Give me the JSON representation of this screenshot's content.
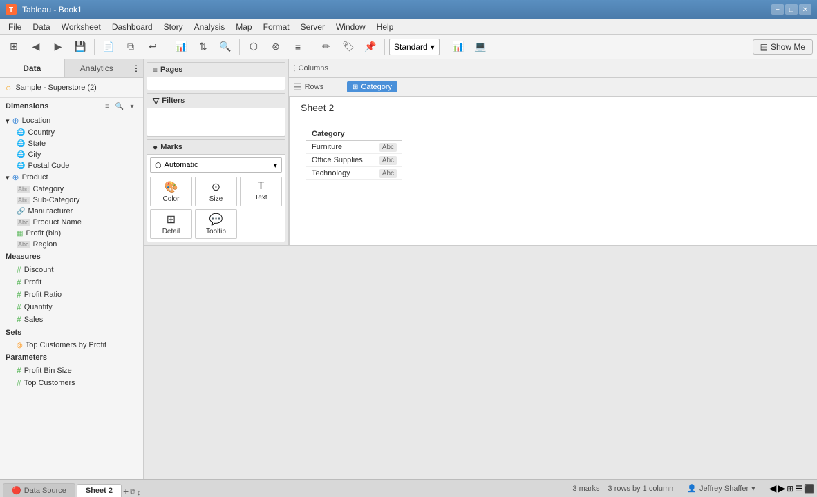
{
  "titleBar": {
    "icon": "T",
    "title": "Tableau - Book1",
    "minimizeBtn": "−",
    "maximizeBtn": "□",
    "closeBtn": "✕"
  },
  "menuBar": {
    "items": [
      "File",
      "Data",
      "Worksheet",
      "Dashboard",
      "Story",
      "Analysis",
      "Map",
      "Format",
      "Server",
      "Window",
      "Help"
    ]
  },
  "toolbar": {
    "standardLabel": "Standard",
    "showMeLabel": "Show Me"
  },
  "leftPanel": {
    "dataTab": "Data",
    "analyticsTab": "Analytics",
    "dataSource": "Sample - Superstore (2)",
    "dimensionsLabel": "Dimensions",
    "measuresLabel": "Measures",
    "setsLabel": "Sets",
    "parametersLabel": "Parameters",
    "location": {
      "groupName": "Location",
      "items": [
        "Country",
        "State",
        "City",
        "Postal Code"
      ]
    },
    "product": {
      "groupName": "Product",
      "items": [
        "Category",
        "Sub-Category",
        "Manufacturer",
        "Product Name",
        "Profit (bin)",
        "Region"
      ]
    },
    "measures": [
      "Discount",
      "Profit",
      "Profit Ratio",
      "Quantity",
      "Sales"
    ],
    "sets": [
      "Top Customers by Profit"
    ],
    "parameters": [
      "Profit Bin Size",
      "Top Customers"
    ]
  },
  "cards": {
    "pagesLabel": "Pages",
    "filtersLabel": "Filters",
    "marksLabel": "Marks",
    "marksType": "Automatic",
    "marksBtns": [
      "Color",
      "Size",
      "Text",
      "Detail",
      "Tooltip"
    ]
  },
  "shelves": {
    "columnsLabel": "Columns",
    "rowsLabel": "Rows",
    "rowsPill": "Category"
  },
  "canvas": {
    "sheetTitle": "Sheet 2",
    "tableHeader": "Category",
    "tableRows": [
      {
        "name": "Furniture",
        "tag": "Abc"
      },
      {
        "name": "Office Supplies",
        "tag": "Abc"
      },
      {
        "name": "Technology",
        "tag": "Abc"
      }
    ]
  },
  "statusBar": {
    "marks": "3 marks",
    "rowsBy": "3 rows by 1 column",
    "user": "Jeffrey Shaffer"
  },
  "sheetTabs": {
    "dataSourceLabel": "Data Source",
    "sheet2Label": "Sheet 2"
  }
}
